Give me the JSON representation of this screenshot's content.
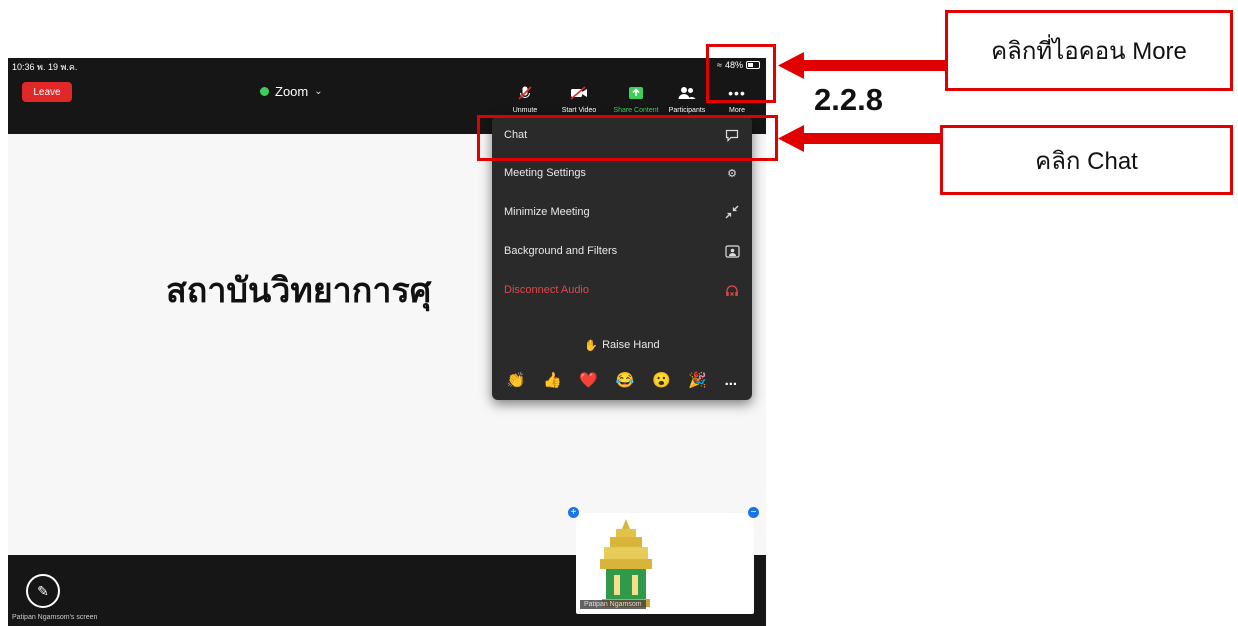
{
  "status_bar": {
    "time": "10:36  พ. 19 พ.ค.",
    "battery": "48%"
  },
  "toolbar": {
    "leave_label": "Leave",
    "title": "Zoom",
    "buttons": [
      "Unmute",
      "Start Video",
      "Share Content",
      "Participants",
      "More"
    ]
  },
  "menu": {
    "items": [
      "Chat",
      "Meeting Settings",
      "Minimize Meeting",
      "Background and Filters",
      "Disconnect Audio"
    ],
    "raise_hand": "Raise Hand",
    "reactions": [
      "👏",
      "👍",
      "❤️",
      "😂",
      "😮",
      "🎉",
      "..."
    ]
  },
  "slide": {
    "text": "สถาบันวิทยาการศุ"
  },
  "bottom": {
    "screen_label": "Patipan Ngamsom's screen"
  },
  "thumbnail": {
    "name": "Patipan Ngamsom"
  },
  "annotations": {
    "more_label": "คลิกที่ไอคอน More",
    "chat_label": "คลิก Chat",
    "step": "2.2.8"
  },
  "colors": {
    "annotation_red": "#e00000",
    "leave_red": "#e02828",
    "share_green": "#3ecf5a",
    "menu_bg": "#2a2a2a"
  }
}
